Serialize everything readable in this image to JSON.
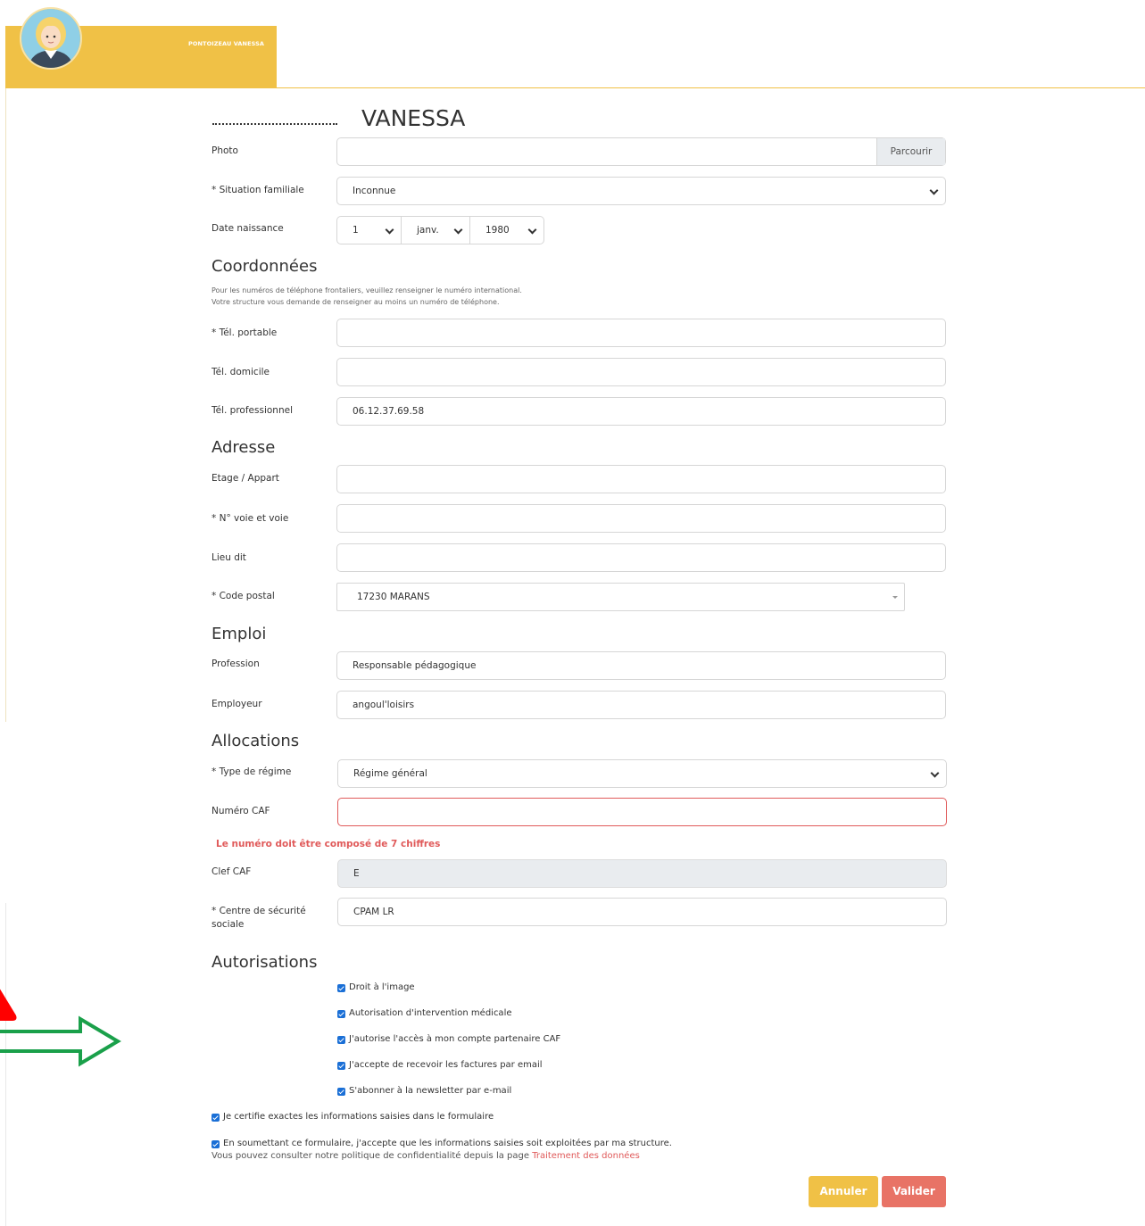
{
  "header": {
    "username": "PONTOIZEAU VANESSA",
    "avatar_icon": "user-avatar-woman"
  },
  "title": {
    "first_name": "VANESSA"
  },
  "identity": {
    "photo_label": "Photo",
    "photo_button": "Parcourir",
    "situation_label": "* Situation familiale",
    "situation_value": "Inconnue",
    "birthdate_label": "Date naissance",
    "birth_day": "1",
    "birth_month": "janv.",
    "birth_year": "1980"
  },
  "contacts": {
    "section_title": "Coordonnées",
    "helper_line1": "Pour les numéros de téléphone frontaliers, veuillez renseigner le numéro international.",
    "helper_line2": "Votre structure vous demande de renseigner au moins un numéro de téléphone.",
    "mobile_label": "* Tél. portable",
    "mobile_value": "",
    "home_label": "Tél. domicile",
    "home_value": "",
    "work_label": "Tél. professionnel",
    "work_value": "06.12.37.69.58"
  },
  "address": {
    "section_title": "Adresse",
    "floor_label": "Etage / Appart",
    "floor_value": "",
    "street_label": "* N° voie et voie",
    "street_value": "",
    "locality_label": "Lieu dit",
    "locality_value": "",
    "postal_label": "* Code postal",
    "postal_value": "17230 MARANS"
  },
  "employment": {
    "section_title": "Emploi",
    "profession_label": "Profession",
    "profession_value": "Responsable pédagogique",
    "employer_label": "Employeur",
    "employer_value": "angoul'loisirs"
  },
  "allocations": {
    "section_title": "Allocations",
    "regime_label": "* Type de régime",
    "regime_value": "Régime général",
    "caf_number_label": "Numéro CAF",
    "caf_number_value": "",
    "caf_error": "Le numéro doit être composé de 7 chiffres",
    "caf_key_label": "Clef CAF",
    "caf_key_value": "E",
    "social_security_label_line1": "* Centre de sécurité",
    "social_security_label_line2": "sociale",
    "social_security_value": "CPAM LR"
  },
  "authorizations": {
    "section_title": "Autorisations",
    "items": [
      "Droit à l'image",
      "Autorisation d'intervention médicale",
      "J'autorise l'accès à mon compte partenaire CAF",
      "J'accepte de recevoir les factures par email",
      "S'abonner à la newsletter par e-mail"
    ],
    "certify": "Je certifie exactes les informations saisies dans le formulaire",
    "consent": "En soumettant ce formulaire, j'accepte que les informations saisies soit exploitées par ma structure.",
    "policy_text": "Vous pouvez consulter notre politique de confidentialité depuis la page ",
    "policy_link": "Traitement des données"
  },
  "actions": {
    "cancel": "Annuler",
    "submit": "Valider"
  },
  "colors": {
    "brand_yellow": "#f0c146",
    "error_red": "#e05a5a",
    "submit_red": "#e87366",
    "checkbox_blue": "#1a6fd6",
    "arrow_green": "#1aa04a"
  }
}
